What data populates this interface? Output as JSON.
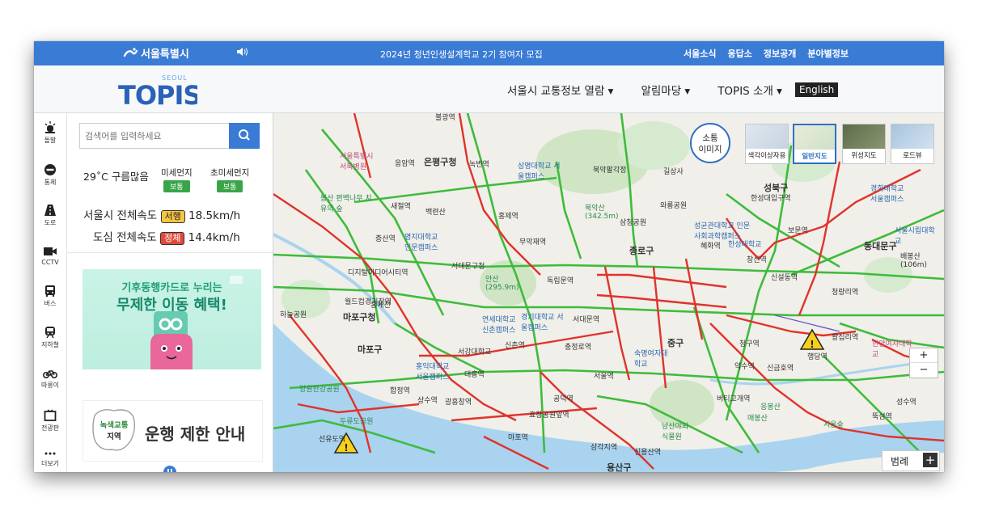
{
  "topbar": {
    "brand": "서울특별시",
    "notice": "2024년 청년인생설계학교 2기 참여자 모집",
    "links": [
      "서울소식",
      "응답소",
      "정보공개",
      "분야별정보"
    ]
  },
  "header": {
    "logo_small": "SEOUL",
    "logo_text": "TOPIS",
    "nav": [
      "서울시 교통정보 열람 ▾",
      "알림마당 ▾",
      "TOPIS 소개 ▾"
    ],
    "english": "English"
  },
  "iconbar": [
    {
      "label": "돌발",
      "icon": "alert-light-icon"
    },
    {
      "label": "통제",
      "icon": "no-entry-icon"
    },
    {
      "label": "도로",
      "icon": "road-icon"
    },
    {
      "label": "CCTV",
      "icon": "camera-icon"
    },
    {
      "label": "버스",
      "icon": "bus-icon"
    },
    {
      "label": "지하철",
      "icon": "subway-icon"
    },
    {
      "label": "따릉이",
      "icon": "bike-icon"
    },
    {
      "label": "전광판",
      "icon": "display-board-icon"
    },
    {
      "label": "더보기",
      "icon": "more-icon"
    }
  ],
  "panel": {
    "search_placeholder": "검색어를 입력하세요",
    "weather": "29˚C 구름많음",
    "dust_label": "미세먼지",
    "dust_value": "보통",
    "fine_dust_label": "초미세먼지",
    "fine_dust_value": "보통",
    "seoul_speed_label": "서울시 전체속도",
    "seoul_speed_status": "서행",
    "seoul_speed_value": "18.5km/h",
    "downtown_speed_label": "도심 전체속도",
    "downtown_speed_status": "정체",
    "downtown_speed_value": "14.4km/h",
    "banner1_line1": "기후동행카드로 누리는",
    "banner1_line2": "무제한 이동 혜택!",
    "banner2_badge_line1": "녹색교통",
    "banner2_badge_line2": "지역",
    "banner2_text": "운행 제한 안내"
  },
  "map": {
    "flow_button": [
      "소통",
      "이미지"
    ],
    "map_types": [
      {
        "label": "색각이상자용",
        "active": false
      },
      {
        "label": "일반지도",
        "active": true
      },
      {
        "label": "위성지도",
        "active": false
      },
      {
        "label": "로드뷰",
        "active": false
      }
    ],
    "zoom_in": "+",
    "zoom_out": "−",
    "legend": "범례",
    "labels": [
      "불광역",
      "은평구청",
      "녹번역",
      "응암역",
      "새절역",
      "북악팔각정",
      "길상사",
      "상명대학교 서울캠퍼스",
      "서울특별시 서북병원",
      "봉산 편백나무 치유의 숲",
      "백련산",
      "홍제역",
      "북악산 (342.5m)",
      "와룡공원",
      "삼청공원",
      "성균관대학교 인문사회과학캠퍼스",
      "성북구",
      "한성대입구역",
      "혜화역",
      "한성대학교",
      "보문역",
      "동대문구",
      "서울시립대학교",
      "배봉산 (106m)",
      "경희대학교 서울캠퍼스",
      "증산역",
      "명지대학교 인문캠퍼스",
      "무악재역",
      "종로구",
      "서대문구청",
      "안산 (295.9m)",
      "디지털미디어시티역",
      "홍제천",
      "월드컵경기장역",
      "하늘공원",
      "마포구청",
      "독립문역",
      "창신역",
      "청량리역",
      "신설동역",
      "마포구",
      "연세대학교 신촌캠퍼스",
      "경기대학교 서울캠퍼스",
      "서대문역",
      "충정로역",
      "신촌역",
      "대흥역",
      "서강대학교",
      "홍익대학교 서울캠퍼스",
      "청구역",
      "왕십리역",
      "행당역",
      "한양여자대학교",
      "성수역",
      "신금호역",
      "약수역",
      "중구",
      "서울역",
      "숙명여자대학교",
      "남산야외식물원",
      "버티고개역",
      "응봉산",
      "뚝섬역",
      "서울숲",
      "매봉산",
      "용산구",
      "효창공원앞역",
      "삼각지역",
      "합정역",
      "상수역",
      "광흥창역",
      "마포역",
      "망원한강공원",
      "선유도역",
      "두류도공원",
      "신용산역",
      "공덕역"
    ]
  }
}
